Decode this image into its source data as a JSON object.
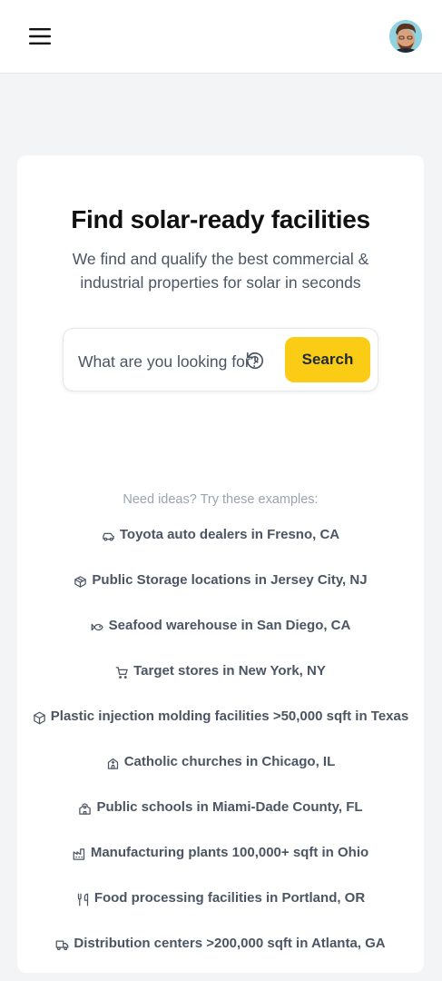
{
  "header": {
    "menu_icon": "hamburger-menu-icon",
    "avatar_alt": "user-avatar"
  },
  "hero": {
    "title": "Find solar-ready facilities",
    "subtitle": "We find and qualify the best commercial & industrial properties for solar in seconds"
  },
  "search": {
    "placeholder": "What are you looking for?",
    "history_icon": "history-icon",
    "button_label": "Search"
  },
  "ideas": {
    "label": "Need ideas? Try these examples:",
    "examples": [
      {
        "icon": "car-icon",
        "text": "Toyota auto dealers in Fresno, CA"
      },
      {
        "icon": "box-icon",
        "text": "Public Storage locations in Jersey City, NJ"
      },
      {
        "icon": "fish-icon",
        "text": "Seafood warehouse in San Diego, CA"
      },
      {
        "icon": "shopping-cart-icon",
        "text": "Target stores in New York, NY"
      },
      {
        "icon": "cube-icon",
        "text": "Plastic injection molding facilities >50,000 sqft in Texas"
      },
      {
        "icon": "church-icon",
        "text": "Catholic churches in Chicago, IL"
      },
      {
        "icon": "school-icon",
        "text": "Public schools in Miami-Dade County, FL"
      },
      {
        "icon": "factory-icon",
        "text": "Manufacturing plants 100,000+ sqft in Ohio"
      },
      {
        "icon": "utensils-icon",
        "text": "Food processing facilities in Portland, OR"
      },
      {
        "icon": "truck-icon",
        "text": "Distribution centers >200,000 sqft in Atlanta, GA"
      }
    ]
  },
  "colors": {
    "accent": "#facc15",
    "background": "#f3f4f6",
    "card": "#ffffff",
    "muted_text": "#4b5563"
  }
}
